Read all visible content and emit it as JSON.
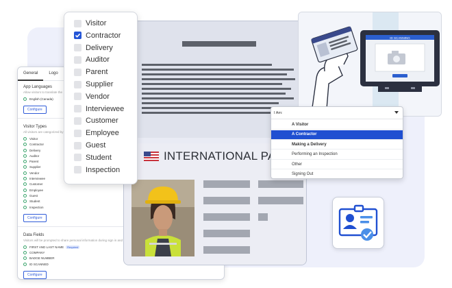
{
  "settings": {
    "tabs": [
      "General",
      "Logo",
      "F"
    ],
    "app_languages": {
      "title": "App Languages",
      "desc": "Allow visitors to translate the",
      "options": [
        "English (Canada)"
      ],
      "button": "Configure"
    },
    "visitor_types": {
      "title": "Visitor Types",
      "desc": "All visitors are categorized by",
      "options": [
        "Visitor",
        "Contractor",
        "Delivery",
        "Auditor",
        "Parent",
        "Supplier",
        "Vendor",
        "Interviewee",
        "Customer",
        "Employee",
        "Guest",
        "Student",
        "Inspection"
      ],
      "button": "Configure"
    },
    "data_fields": {
      "title": "Data Fields",
      "desc": "Visitors will be prompted to share personal information during sign in and",
      "options": [
        "FIRST AND LAST NAME",
        "COMPANY",
        "BADGE NUMBER",
        "ID SCANNED"
      ],
      "required_badge": "Required",
      "button": "Configure"
    },
    "ring_color": "#37a36a",
    "accent_color": "#2f5bd8"
  },
  "checklist": {
    "items": [
      {
        "label": "Visitor",
        "checked": false
      },
      {
        "label": "Contractor",
        "checked": true
      },
      {
        "label": "Delivery",
        "checked": false
      },
      {
        "label": "Auditor",
        "checked": false
      },
      {
        "label": "Parent",
        "checked": false
      },
      {
        "label": "Supplier",
        "checked": false
      },
      {
        "label": "Vendor",
        "checked": false
      },
      {
        "label": "Interviewee",
        "checked": false
      },
      {
        "label": "Customer",
        "checked": false
      },
      {
        "label": "Employee",
        "checked": false
      },
      {
        "label": "Guest",
        "checked": false
      },
      {
        "label": "Student",
        "checked": false
      },
      {
        "label": "Inspection",
        "checked": false
      }
    ],
    "check_color": "#2455d6"
  },
  "passport": {
    "title": "INTERNATIONAL PASSPORT",
    "flag_icon": "us-flag-icon",
    "photo_icon": "worker-hardhat-photo"
  },
  "dropdown": {
    "label": "I Am:",
    "options": [
      {
        "label": "A Visitor",
        "state": "bold"
      },
      {
        "label": "A Contractor",
        "state": "selected"
      },
      {
        "label": "Making a Delivery",
        "state": "bold"
      },
      {
        "label": "Performing an Inspection",
        "state": "normal"
      },
      {
        "label": "Other",
        "state": "normal"
      },
      {
        "label": "Signing Out",
        "state": "normal"
      }
    ],
    "selected_color": "#1f4fd1"
  },
  "kiosk": {
    "screen_title": "ID SCANNING",
    "icon": "camera-icon"
  },
  "badge": {
    "icon": "visitor-badge-check-icon",
    "color": "#1f4fd1"
  }
}
